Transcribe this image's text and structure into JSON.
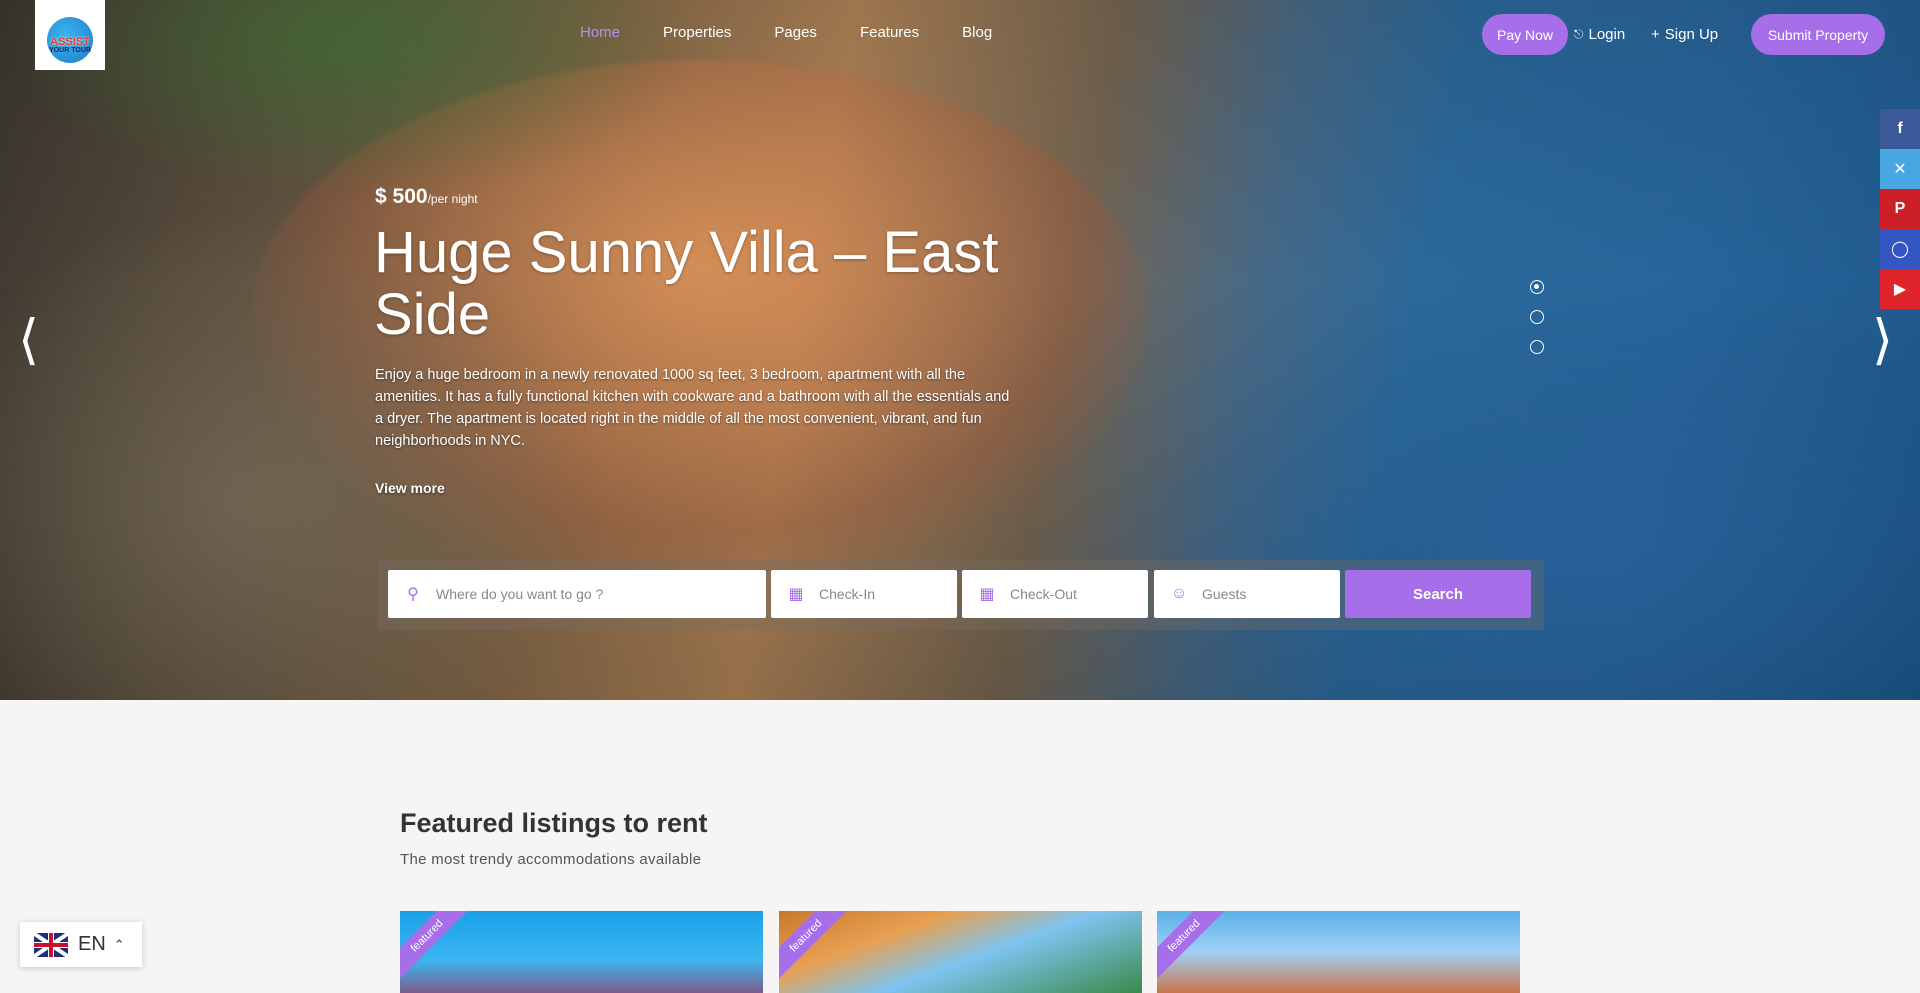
{
  "brand": {
    "logo_text": "ASSIST",
    "logo_sub": "YOUR TOUR"
  },
  "nav": {
    "links": [
      "Home",
      "Properties",
      "Pages",
      "Features",
      "Blog"
    ],
    "active": "Home",
    "pay_now": "Pay Now",
    "login": "Login",
    "signup": "Sign Up",
    "submit_property": "Submit Property"
  },
  "social": [
    "facebook-icon",
    "x-icon",
    "pinterest-icon",
    "instagram-icon",
    "youtube-icon"
  ],
  "hero": {
    "price": "$ 500",
    "per": "/per night",
    "title": "Huge Sunny Villa – East Side",
    "description": "Enjoy a huge bedroom in a newly renovated 1000 sq feet, 3 bedroom, apartment with all the amenities. It has a fully functional kitchen with cookware and a bathroom with all the essentials and a dryer. The apartment is located right in the middle of all the most convenient, vibrant, and fun neighborhoods in NYC.",
    "view_more": "View more",
    "slide_count": 3,
    "active_slide": 1
  },
  "search": {
    "destination_placeholder": "Where do you want to go ?",
    "checkin_placeholder": "Check-In",
    "checkout_placeholder": "Check-Out",
    "guests_placeholder": "Guests",
    "button": "Search"
  },
  "featured": {
    "title": "Featured listings to rent",
    "subtitle": "The most trendy accommodations available",
    "ribbon": "featured"
  },
  "language": {
    "code": "EN"
  },
  "colors": {
    "accent": "#a66ee8"
  }
}
